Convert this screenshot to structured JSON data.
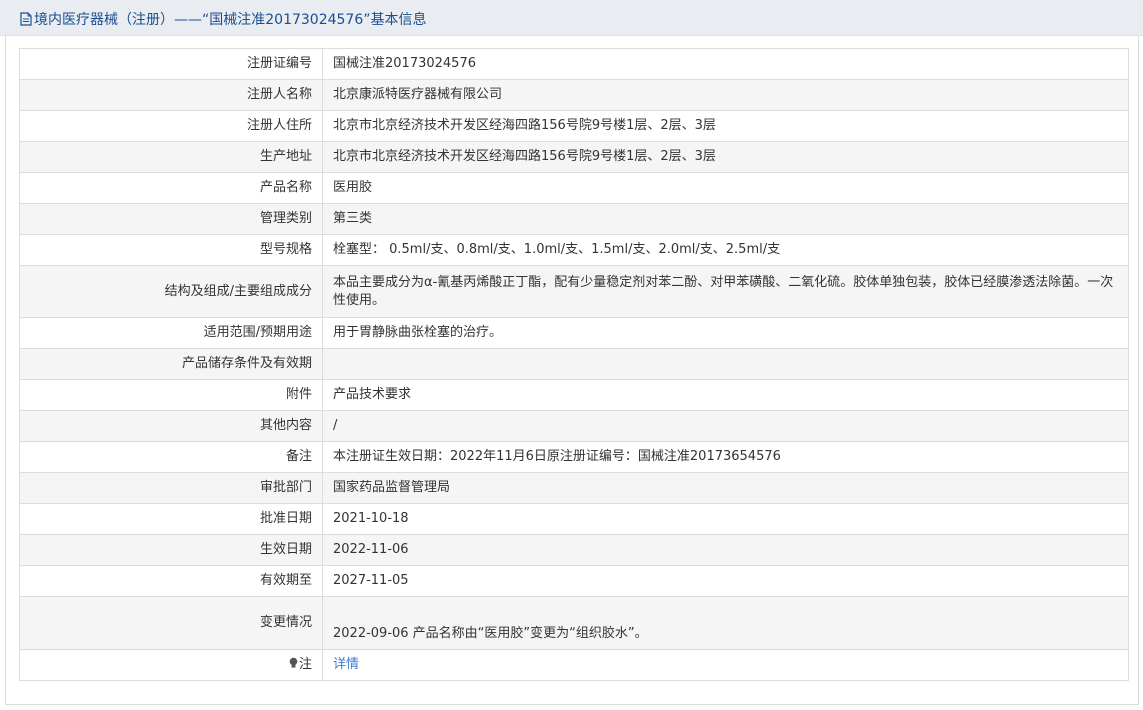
{
  "header": {
    "title": "境内医疗器械（注册）——“国械注准20173024576”基本信息",
    "icon": "document-icon"
  },
  "rows": [
    {
      "label": "注册证编号",
      "value": "国械注准20173024576"
    },
    {
      "label": "注册人名称",
      "value": "北京康派特医疗器械有限公司"
    },
    {
      "label": "注册人住所",
      "value": "北京市北京经济技术开发区经海四路156号院9号楼1层、2层、3层"
    },
    {
      "label": "生产地址",
      "value": "北京市北京经济技术开发区经海四路156号院9号楼1层、2层、3层"
    },
    {
      "label": "产品名称",
      "value": "医用胶"
    },
    {
      "label": "管理类别",
      "value": "第三类"
    },
    {
      "label": "型号规格",
      "value": "栓塞型： 0.5ml/支、0.8ml/支、1.0ml/支、1.5ml/支、2.0ml/支、2.5ml/支"
    },
    {
      "label": "结构及组成/主要组成成分",
      "value": "本品主要成分为α-氰基丙烯酸正丁酯，配有少量稳定剂对苯二酚、对甲苯磺酸、二氧化硫。胶体单独包装，胶体已经膜渗透法除菌。一次性使用。"
    },
    {
      "label": "适用范围/预期用途",
      "value": "用于胃静脉曲张栓塞的治疗。"
    },
    {
      "label": "产品储存条件及有效期",
      "value": ""
    },
    {
      "label": "附件",
      "value": "产品技术要求"
    },
    {
      "label": "其他内容",
      "value": "/"
    },
    {
      "label": "备注",
      "value": "本注册证生效日期：2022年11月6日原注册证编号：国械注准20173654576"
    },
    {
      "label": "审批部门",
      "value": "国家药品监督管理局"
    },
    {
      "label": "批准日期",
      "value": "2021-10-18"
    },
    {
      "label": "生效日期",
      "value": "2022-11-06"
    },
    {
      "label": "有效期至",
      "value": "2027-11-05"
    },
    {
      "label": "变更情况",
      "value": "2022-09-06 产品名称由“医用胶”变更为“组织胶水”。"
    }
  ],
  "note": {
    "label": "注",
    "icon": "lightbulb-icon",
    "link_text": "详情"
  },
  "colors": {
    "title": "#1a4f8f",
    "link": "#3a7bd5",
    "stripe": "#f5f5f5",
    "border": "#dcdcdc"
  }
}
